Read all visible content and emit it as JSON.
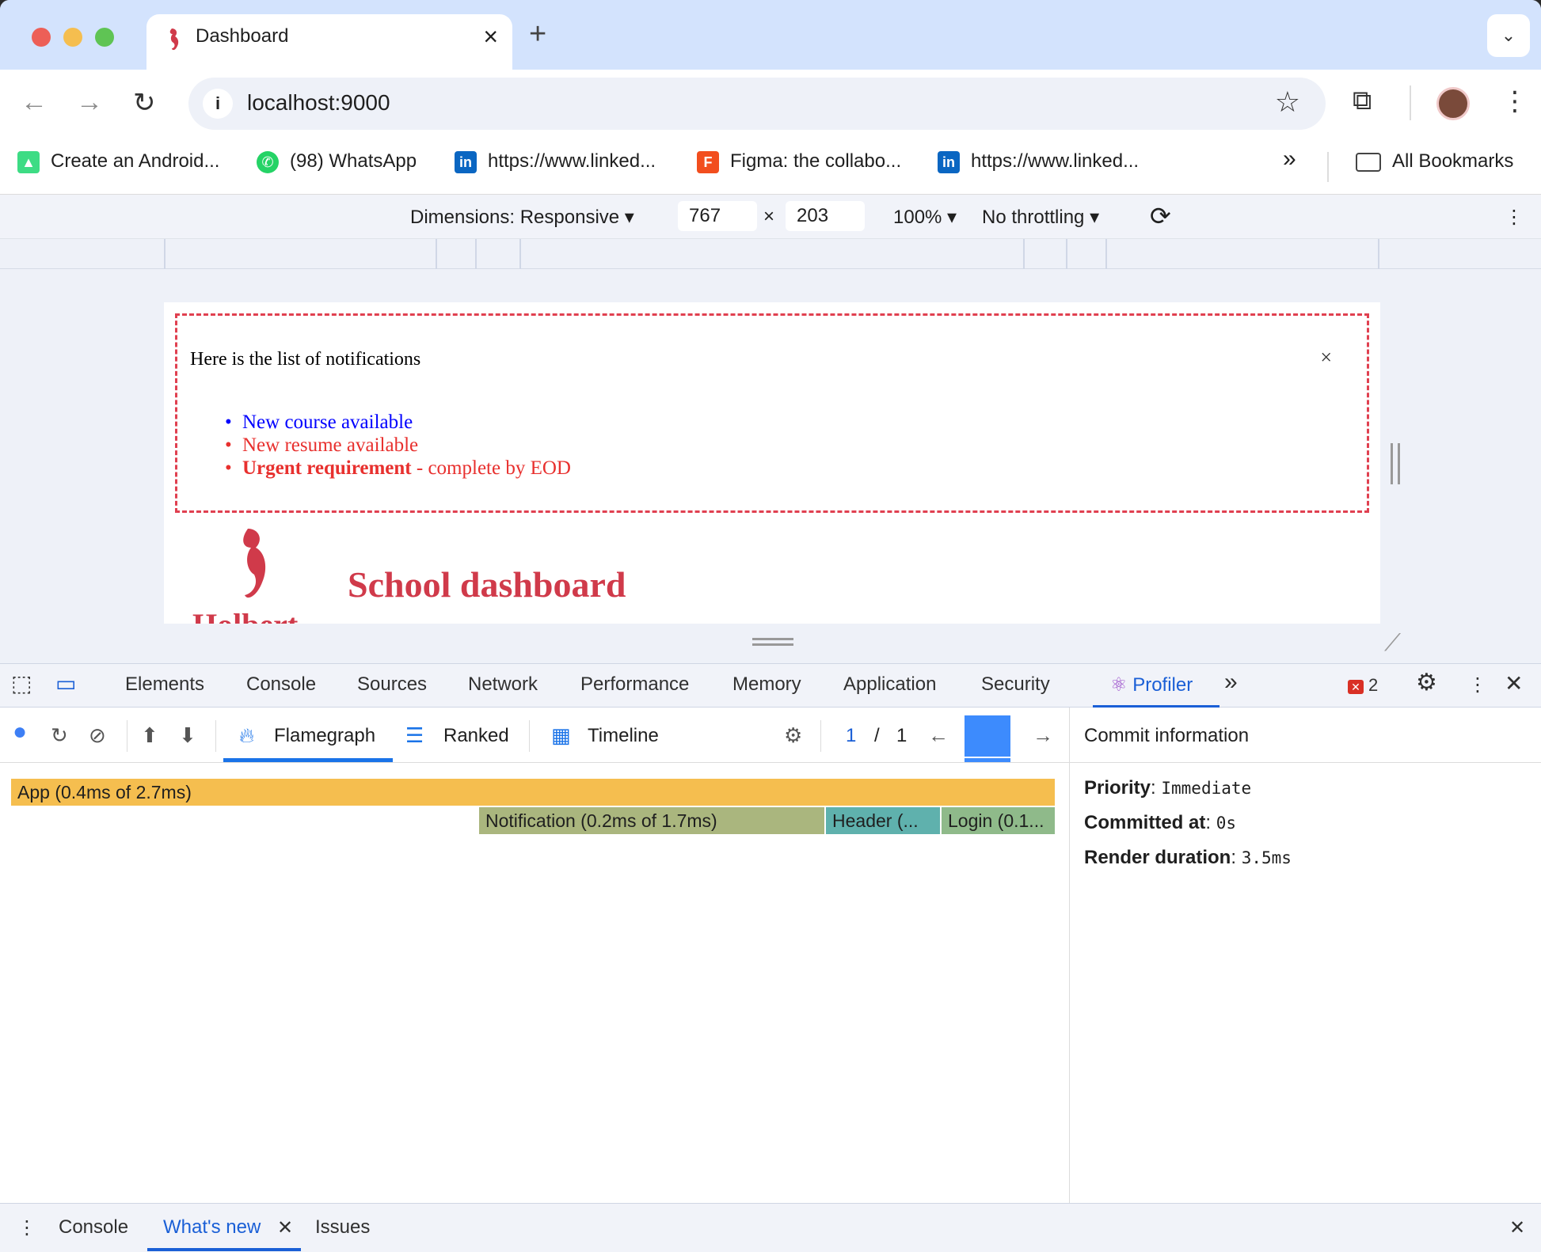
{
  "browser": {
    "tab_title": "Dashboard",
    "new_tab": "+",
    "close_tab": "×",
    "url": "localhost:9000"
  },
  "bookmarks": [
    {
      "label": "Create an Android...",
      "icon": "android-icon",
      "color": "#3ddc84"
    },
    {
      "label": "(98) WhatsApp",
      "icon": "whatsapp-icon",
      "color": "#25d366"
    },
    {
      "label": "https://www.linked...",
      "icon": "linkedin-icon",
      "color": "#0a66c2"
    },
    {
      "label": "Figma: the collabo...",
      "icon": "figma-icon",
      "color": "#f24e1e"
    },
    {
      "label": "https://www.linked...",
      "icon": "linkedin-icon",
      "color": "#0a66c2"
    }
  ],
  "bookmarks_more": "»",
  "all_bookmarks": "All Bookmarks",
  "device_toolbar": {
    "dimensions": "Dimensions: Responsive ▾",
    "width": "767",
    "times": "×",
    "height": "203",
    "zoom": "100% ▾",
    "throttling": "No throttling ▾"
  },
  "page": {
    "notification_intro": "Here is the list of notifications",
    "close_glyph": "×",
    "items": [
      {
        "text": "New course available",
        "color": "#0000ff"
      },
      {
        "text": "New resume available",
        "color": "#e8302e"
      }
    ],
    "urgent_bold": "Urgent requirement",
    "urgent_rest": " - complete by EOD",
    "title": "School dashboard",
    "partial_text": "Holbert"
  },
  "devtools": {
    "tabs": [
      "Elements",
      "Console",
      "Sources",
      "Network",
      "Performance",
      "Memory",
      "Application",
      "Security"
    ],
    "profiler_tab": "Profiler",
    "more_tabs": "»",
    "error_count": "2"
  },
  "profiler": {
    "flamegraph": "Flamegraph",
    "ranked": "Ranked",
    "timeline": "Timeline",
    "commit_index": "1",
    "commit_sep": "/",
    "commit_total": "1",
    "bars": {
      "app": "App (0.4ms of 2.7ms)",
      "notification": "Notification (0.2ms of 1.7ms)",
      "header": "Header (...",
      "login": "Login (0.1..."
    },
    "colors": {
      "app": "#f5be4f",
      "notification": "#aab67e",
      "header": "#5fb1ad",
      "login": "#8fba8a"
    }
  },
  "commit_info": {
    "header": "Commit information",
    "priority_label": "Priority",
    "priority_value": "Immediate",
    "committed_label": "Committed at",
    "committed_value": "0s",
    "render_label": "Render duration",
    "render_value": "3.5ms"
  },
  "drawer": {
    "console": "Console",
    "whats_new": "What's new",
    "issues": "Issues"
  }
}
